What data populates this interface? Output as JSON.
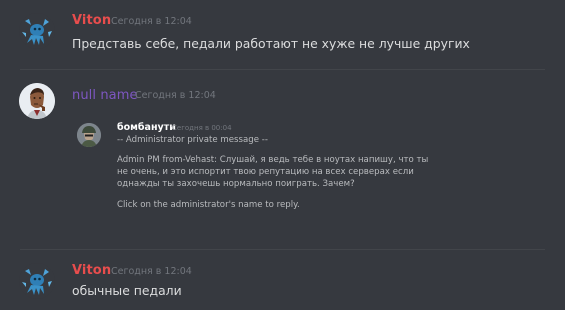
{
  "messages": [
    {
      "username": "Viton",
      "timestamp": "Сегодня в 12:04",
      "text": "Представь себе, педали работают не хуже не лучше других"
    },
    {
      "username": "null name",
      "timestamp": "Сегодня в 12:04",
      "embed": {
        "username": "бомбанути",
        "timestamp": "Сегодня в 00:04",
        "lines": [
          "-- Administrator private message --",
          "Admin PM from-Vehast: Слушай, я ведь тебе в ноутах напишу, что ты",
          "не очень, и это испортит твою репутацию на всех серверах если",
          "однажды ты захочешь нормально поиграть. Зачем?",
          "Click on the administrator's name to reply."
        ]
      }
    },
    {
      "username": "Viton",
      "timestamp": "Сегодня в 12:04",
      "text": "обычные педали"
    }
  ],
  "colors": {
    "background": "#36393f",
    "viton_name": "#e84d4d",
    "null_name": "#7e57c2",
    "text": "#dcddde",
    "timestamp": "#72767d",
    "embed_text": "#b9bbbe"
  },
  "icons": {
    "viton_avatar": "blue-creature-avatar",
    "null_name_avatar": "man-with-pipe-avatar",
    "embed_avatar": "soldier-avatar"
  }
}
